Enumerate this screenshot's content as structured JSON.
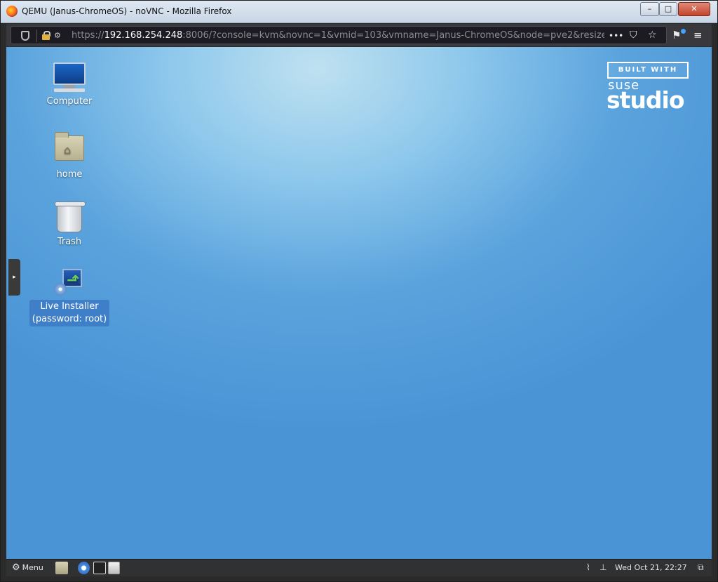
{
  "window": {
    "title": "QEMU (Janus-ChromeOS) - noVNC - Mozilla Firefox",
    "minimize": "–",
    "maximize": "□",
    "close": "✕"
  },
  "browser": {
    "url_scheme": "https://",
    "url_host": "192.168.254.248",
    "url_rest": ":8006/?console=kvm&novnc=1&vmid=103&vmname=Janus-ChromeOS&node=pve2&resize=",
    "permissions_glyph": "⚙",
    "more_glyph": "•••",
    "pocket_glyph": "⛉",
    "star_glyph": "☆",
    "extension_glyph": "⚑",
    "menu_glyph": "≡"
  },
  "desktop": {
    "icons": [
      {
        "label": "Computer"
      },
      {
        "label": "home"
      },
      {
        "label": "Trash"
      },
      {
        "label_line1": "Live Installer",
        "label_line2": "(password: root)"
      }
    ],
    "badge": {
      "built_with": "BUILT WITH",
      "brand_top": "suse",
      "brand_main": "studio"
    },
    "handle_glyph": "▸"
  },
  "taskbar": {
    "menu_label": "Menu",
    "menu_icon": "gear-icon",
    "clock": "Wed Oct 21, 22:27"
  },
  "colors": {
    "desktop_accent": "#4a94d6",
    "selection": "#3f7fc7",
    "taskbar": "#2f3133"
  }
}
